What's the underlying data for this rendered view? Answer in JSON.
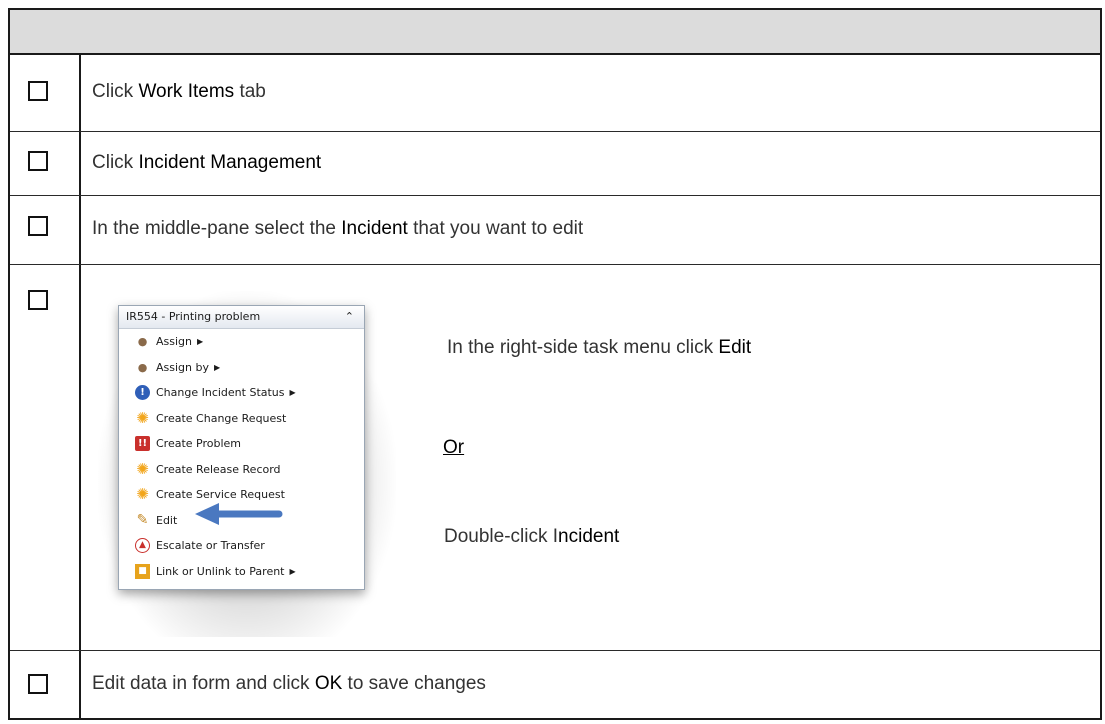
{
  "steps": [
    {
      "pre": "Click ",
      "bold": "Work Items",
      "post": " tab"
    },
    {
      "pre": "Click ",
      "bold": "Incident Management",
      "post": ""
    },
    {
      "pre": "In the middle-pane select the ",
      "bold": "Incident",
      "post": " that you want to edit"
    },
    {
      "menu": {
        "title": "IR554 - Printing problem",
        "items": [
          {
            "label": "Assign",
            "icon": "user-icon",
            "submenu": true
          },
          {
            "label": "Assign by",
            "icon": "user-icon",
            "submenu": true
          },
          {
            "label": "Change Incident Status",
            "icon": "info-icon",
            "submenu": true
          },
          {
            "label": "Create Change Request",
            "icon": "star-icon",
            "submenu": false
          },
          {
            "label": "Create Problem",
            "icon": "problem-icon",
            "submenu": false
          },
          {
            "label": "Create Release Record",
            "icon": "star-icon",
            "submenu": false
          },
          {
            "label": "Create Service Request",
            "icon": "star-icon",
            "submenu": false
          },
          {
            "label": "Edit",
            "icon": "pencil-icon",
            "submenu": false
          },
          {
            "label": "Escalate or Transfer",
            "icon": "escalate-icon",
            "submenu": false
          },
          {
            "label": "Link or Unlink to Parent",
            "icon": "link-icon",
            "submenu": true
          }
        ]
      },
      "line1_pre": "In the right-side task menu click ",
      "line1_bold": "Edit",
      "or_label": "Or",
      "line3_pre": "Double-click I",
      "line3_bold": "ncident"
    },
    {
      "pre": "Edit data in form and click ",
      "bold": "OK",
      "post": " to save changes"
    }
  ]
}
